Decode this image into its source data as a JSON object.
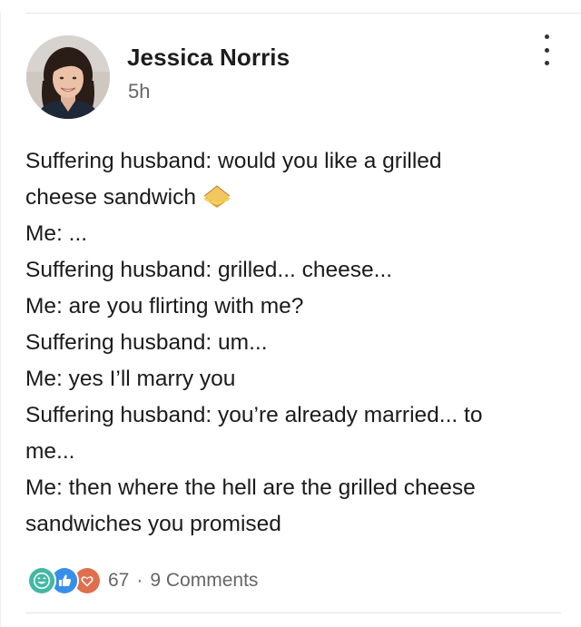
{
  "post": {
    "author": {
      "name": "Jessica Norris",
      "avatar_icon": "profile-photo"
    },
    "timestamp": "5h",
    "more_icon": "vertical-ellipsis-icon",
    "lines": [
      "Suffering husband: would you like a grilled",
      "cheese sandwich",
      "Me: ...",
      "Suffering husband: grilled... cheese...",
      "Me: are you flirting with me?",
      "Suffering husband: um...",
      "Me: yes I’ll marry you",
      "Suffering husband: you’re already married... to",
      "me...",
      "Me: then where the hell are the grilled cheese",
      "sandwiches you promised"
    ],
    "emoji_icon": "sandwich-emoji"
  },
  "social": {
    "reaction_icons": [
      "funny-icon",
      "like-icon",
      "love-icon"
    ],
    "reaction_colors": {
      "funny": "#44b8a5",
      "like": "#378fe9",
      "love": "#df704d"
    },
    "reaction_count": "67",
    "separator": "·",
    "comments": "9 Comments"
  }
}
